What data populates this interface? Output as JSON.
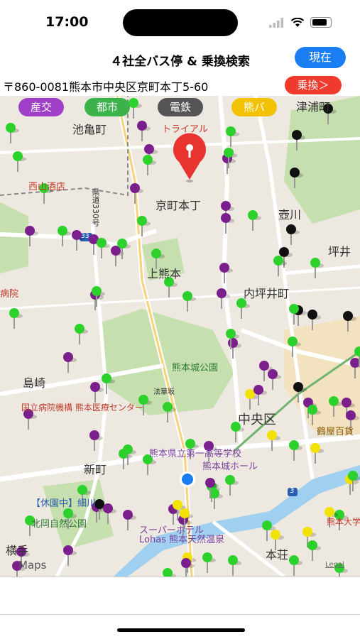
{
  "status": {
    "time": "17:00"
  },
  "header": {
    "title": "４社全バス停 & 乗換検索",
    "now_label": "現在"
  },
  "address": {
    "text": "〒860-0081熊本市中央区京町本丁5-60",
    "transfer_label": "乗換＞"
  },
  "filters": [
    {
      "label": "産交",
      "color": "#a040c8"
    },
    {
      "label": "都市",
      "color": "#3cb34a"
    },
    {
      "label": "電鉄",
      "color": "#555555"
    },
    {
      "label": "熊バ",
      "color": "#f2c200"
    }
  ],
  "map": {
    "labels": {
      "ikekame": "池亀町",
      "traial": "トライアル",
      "tsuura": "津浦町",
      "nishiyama": "西山酒店",
      "route330": "県道330号",
      "kyomachi": "京町本丁",
      "tsubogawa": "壺川",
      "tsuboi": "坪井",
      "kamikumamoto": "上熊本",
      "uchitsuboi": "内坪井町",
      "hospital": "病院",
      "kumamotojo": "熊本城公園",
      "shimazaki": "島崎",
      "hoka": "法華坂",
      "medical": "国立病院機構 熊本医療センター",
      "chuoku": "中央区",
      "tsuruya": "鶴屋百貨",
      "school": "熊本県立第一高等学校",
      "castlehall": "熊本城ホール",
      "shinmachi": "新町",
      "hosokawa": "【休園中】細川",
      "kitaoka": "北岡自然公園",
      "superhotel": "スーパーホテル",
      "lohas": "Lohas 熊本天然温泉",
      "kumadai": "熊本大学",
      "yokote": "横手",
      "honjo": "本荘",
      "maps": "Maps",
      "legal": "Legal",
      "road3": "3",
      "road33": "33"
    }
  }
}
